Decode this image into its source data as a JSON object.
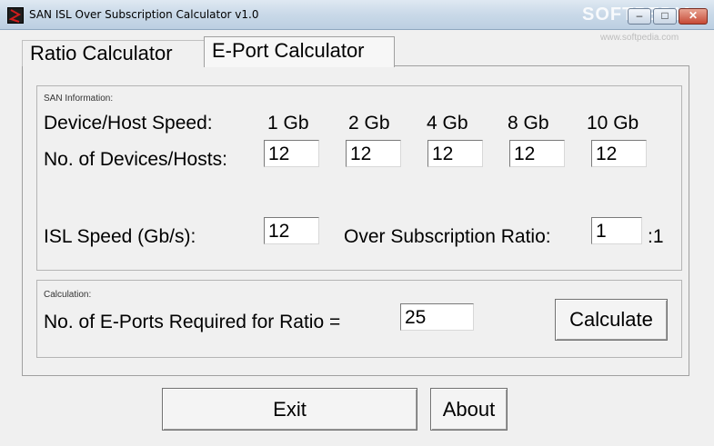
{
  "window": {
    "title": "SAN ISL Over Subscription Calculator v1.0",
    "watermark": "SOFTPEDIA",
    "watermark_url": "www.softpedia.com",
    "controls": {
      "minimize": "–",
      "maximize": "□",
      "close": "✕"
    }
  },
  "tabs": [
    {
      "label": "Ratio Calculator",
      "active": false
    },
    {
      "label": "E-Port Calculator",
      "active": true
    }
  ],
  "san_info": {
    "group_label": "SAN Information:",
    "device_speed_label": "Device/Host Speed:",
    "speeds": [
      "1 Gb",
      "2 Gb",
      "4 Gb",
      "8 Gb",
      "10 Gb"
    ],
    "devices_label": "No. of Devices/Hosts:",
    "devices": [
      "12",
      "12",
      "12",
      "12",
      "12"
    ],
    "isl_speed_label": "ISL Speed (Gb/s):",
    "isl_speed": "12",
    "ratio_label": "Over Subscription Ratio:",
    "ratio": "1",
    "ratio_suffix": ":1"
  },
  "calculation": {
    "group_label": "Calculation:",
    "eports_label": "No. of E-Ports Required for Ratio =",
    "eports_value": "25",
    "calculate_label": "Calculate"
  },
  "footer": {
    "exit_label": "Exit",
    "about_label": "About"
  },
  "colors": {
    "app_icon": "#d01c1c",
    "title_bar": "#c9d9e8"
  }
}
